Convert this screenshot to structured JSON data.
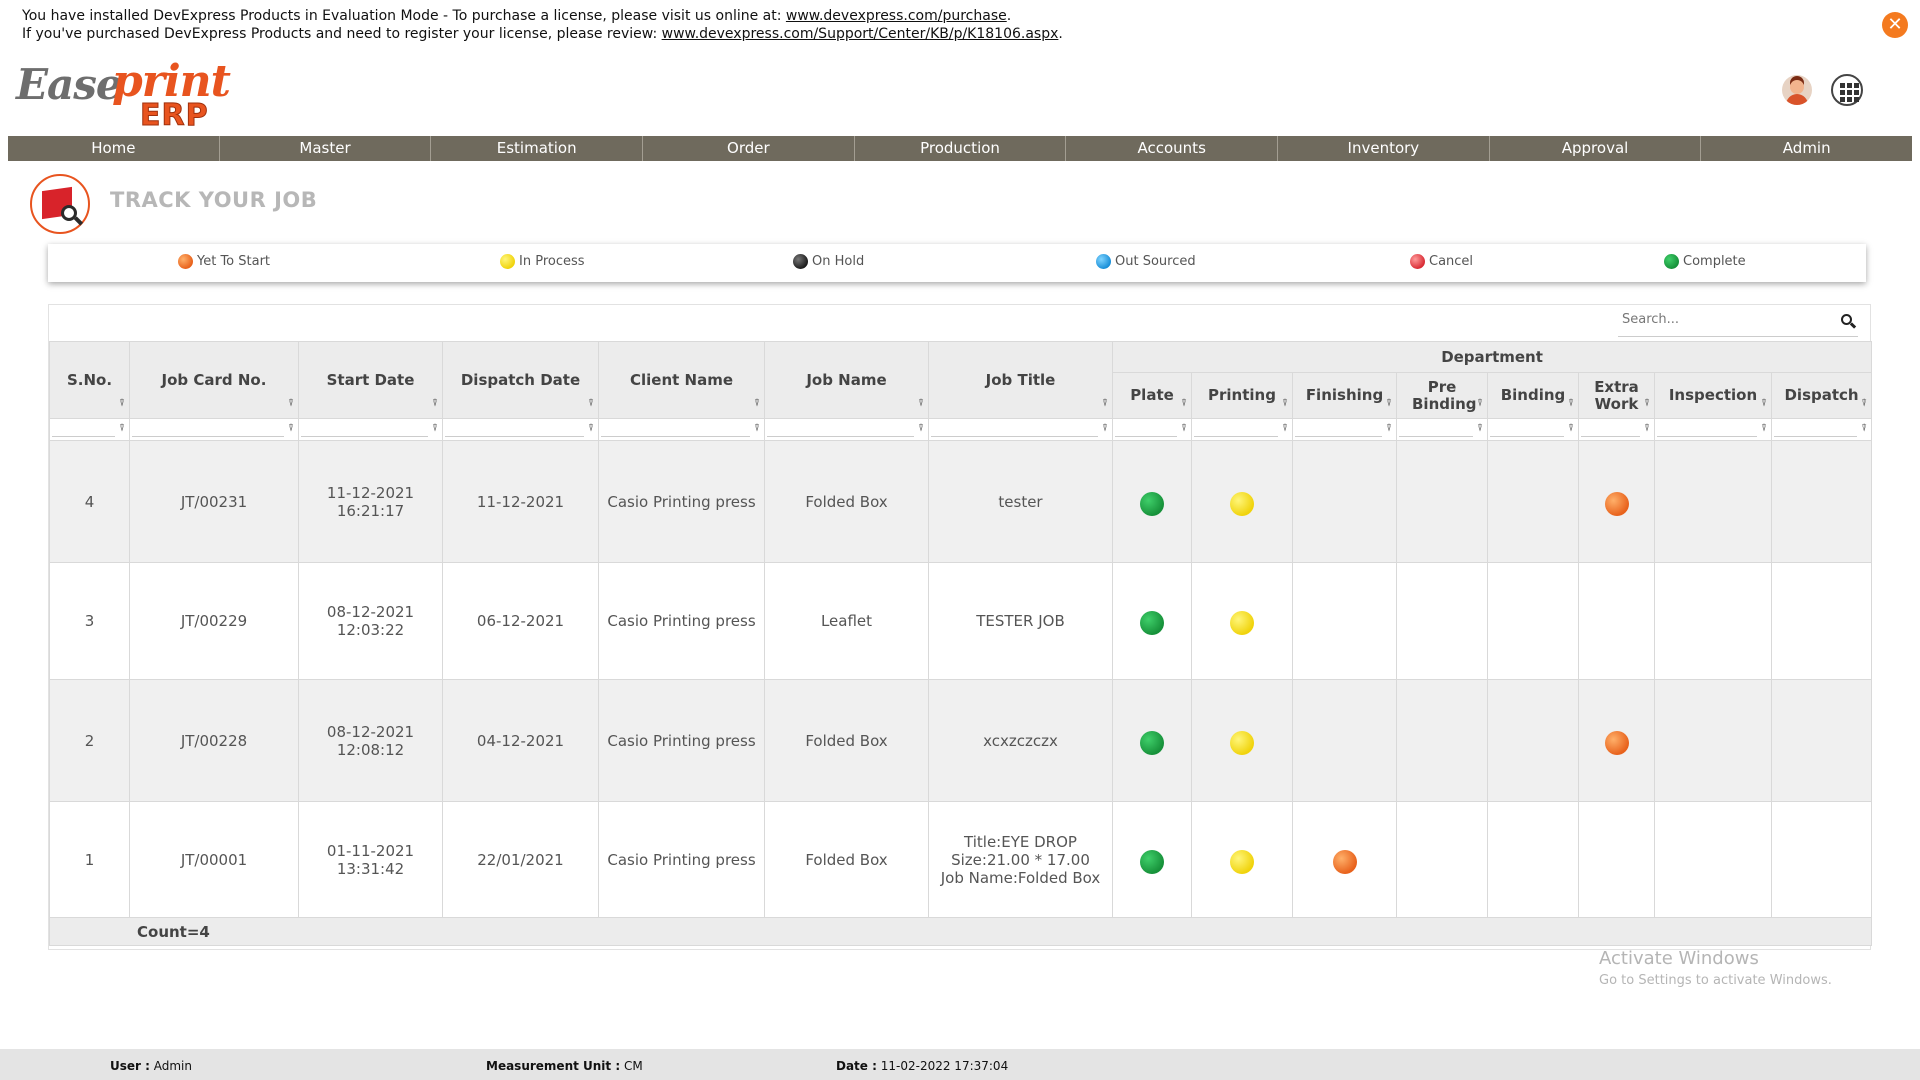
{
  "banner": {
    "line1_text": "You have installed DevExpress Products in Evaluation Mode - To purchase a license, please visit us online at: ",
    "line1_link": "www.devexpress.com/purchase",
    "line1_end": ".",
    "line2_text": "If you've purchased DevExpress Products and need to register your license, please review: ",
    "line2_link": "www.devexpress.com/Support/Center/KB/p/K18106.aspx",
    "line2_end": ".",
    "close_glyph": "✕"
  },
  "logo": {
    "part1": "Ease",
    "part2": "print",
    "part3": "ERP"
  },
  "nav": [
    "Home",
    "Master",
    "Estimation",
    "Order",
    "Production",
    "Accounts",
    "Inventory",
    "Approval",
    "Admin"
  ],
  "page": {
    "title": "TRACK YOUR JOB"
  },
  "legend": [
    {
      "label": "Yet To Start",
      "color": "orange"
    },
    {
      "label": "In Process",
      "color": "yellow"
    },
    {
      "label": "On Hold",
      "color": "black"
    },
    {
      "label": "Out Sourced",
      "color": "blue"
    },
    {
      "label": "Cancel",
      "color": "red"
    },
    {
      "label": "Complete",
      "color": "green"
    }
  ],
  "search": {
    "placeholder": "Search...",
    "value": ""
  },
  "grid": {
    "headers": {
      "sno": "S.No.",
      "job_card": "Job Card No.",
      "start_date": "Start Date",
      "dispatch_date": "Dispatch Date",
      "client_name": "Client Name",
      "job_name": "Job Name",
      "job_title": "Job Title",
      "department": "Department"
    },
    "dept_headers": [
      "Plate",
      "Printing",
      "Finishing",
      "Pre Binding",
      "Binding",
      "Extra Work",
      "Inspection",
      "Dispatch"
    ],
    "rows": [
      {
        "sno": "4",
        "job_card": "JT/00231",
        "start_date": "11-12-2021",
        "start_time": "16:21:17",
        "dispatch_date": "11-12-2021",
        "client_name": "Casio Printing press",
        "job_name": "Folded Box",
        "job_title": [
          "tester"
        ],
        "status": [
          "green",
          "yellow",
          "",
          "",
          "",
          "orange",
          "",
          ""
        ]
      },
      {
        "sno": "3",
        "job_card": "JT/00229",
        "start_date": "08-12-2021",
        "start_time": "12:03:22",
        "dispatch_date": "06-12-2021",
        "client_name": "Casio Printing press",
        "job_name": "Leaflet",
        "job_title": [
          "TESTER JOB"
        ],
        "status": [
          "green",
          "yellow",
          "",
          "",
          "",
          "",
          "",
          ""
        ]
      },
      {
        "sno": "2",
        "job_card": "JT/00228",
        "start_date": "08-12-2021",
        "start_time": "12:08:12",
        "dispatch_date": "04-12-2021",
        "client_name": "Casio Printing press",
        "job_name": "Folded Box",
        "job_title": [
          "xcxzczczx"
        ],
        "status": [
          "green",
          "yellow",
          "",
          "",
          "",
          "orange",
          "",
          ""
        ]
      },
      {
        "sno": "1",
        "job_card": "JT/00001",
        "start_date": "01-11-2021",
        "start_time": "13:31:42",
        "dispatch_date": "22/01/2021",
        "client_name": "Casio Printing press",
        "job_name": "Folded Box",
        "job_title": [
          "Title:EYE DROP",
          "Size:21.00 * 17.00",
          "Job Name:Folded Box"
        ],
        "status": [
          "green",
          "yellow",
          "orange",
          "",
          "",
          "",
          "",
          ""
        ]
      }
    ],
    "count_label": "Count=4"
  },
  "watermark": {
    "line1": "Activate Windows",
    "line2": "Go to Settings to activate Windows."
  },
  "statusbar": {
    "user_label": "User :",
    "user_value": "Admin",
    "unit_label": "Measurement Unit :",
    "unit_value": "CM",
    "date_label": "Date :",
    "date_value": "11-02-2022 17:37:04"
  }
}
